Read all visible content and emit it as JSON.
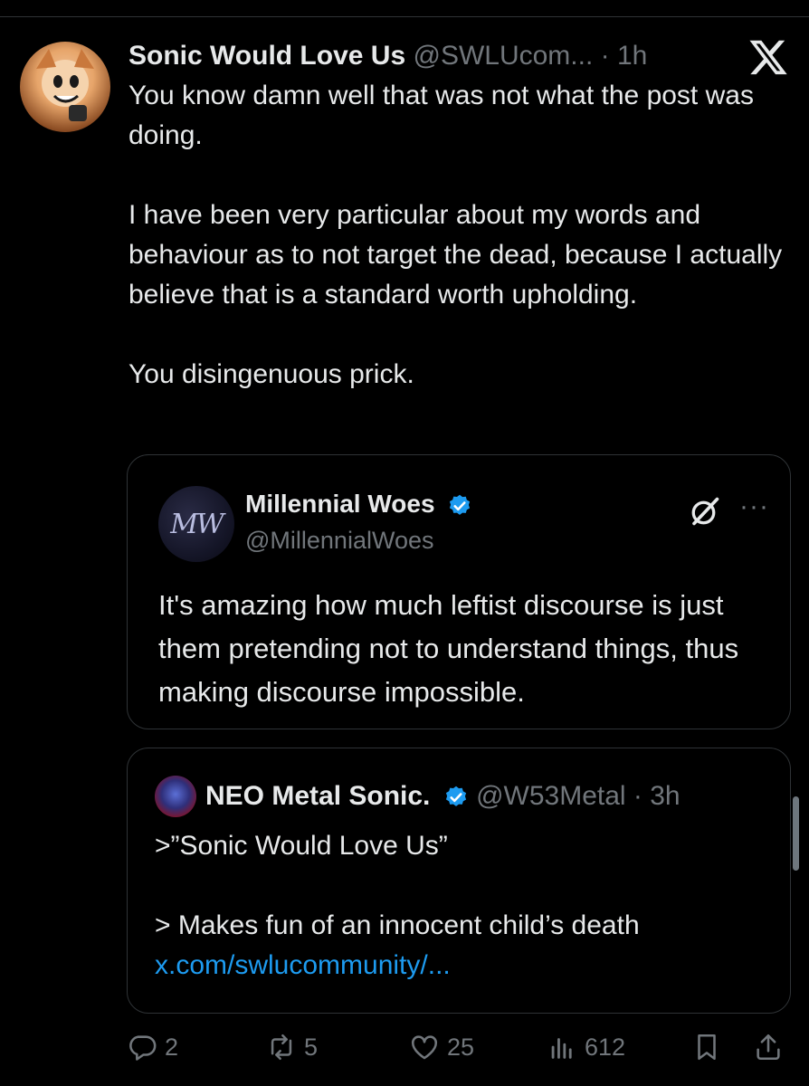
{
  "post": {
    "author_name": "Sonic Would Love Us",
    "author_handle": "@SWLUcom...",
    "time": "· 1h",
    "paragraphs": [
      "You know damn well that was not what the post was doing.",
      "I have been very particular about my words and behaviour as to not target the dead, because I actually believe that is a standard worth upholding.",
      "You disingenuous prick."
    ]
  },
  "quote1": {
    "avatar_text": "MW",
    "author_name": "Millennial Woes",
    "author_handle": "@MillennialWoes",
    "more": "···",
    "text": "It's amazing how much leftist discourse is just them pretending not to understand things, thus making discourse impossible."
  },
  "quote2": {
    "author_name": "NEO Metal Sonic.",
    "author_handle": "@W53Metal",
    "time": "· 3h",
    "line1": ">”Sonic Would Love Us”",
    "line2": "> Makes fun of an innocent child’s death",
    "link": "x.com/swlucommunity/..."
  },
  "actions": {
    "replies": "2",
    "reposts": "5",
    "likes": "25",
    "views": "612"
  },
  "colors": {
    "background": "#000000",
    "text": "#e7e9ea",
    "muted": "#71767b",
    "link": "#1d9bf0",
    "border": "#2f3336"
  }
}
